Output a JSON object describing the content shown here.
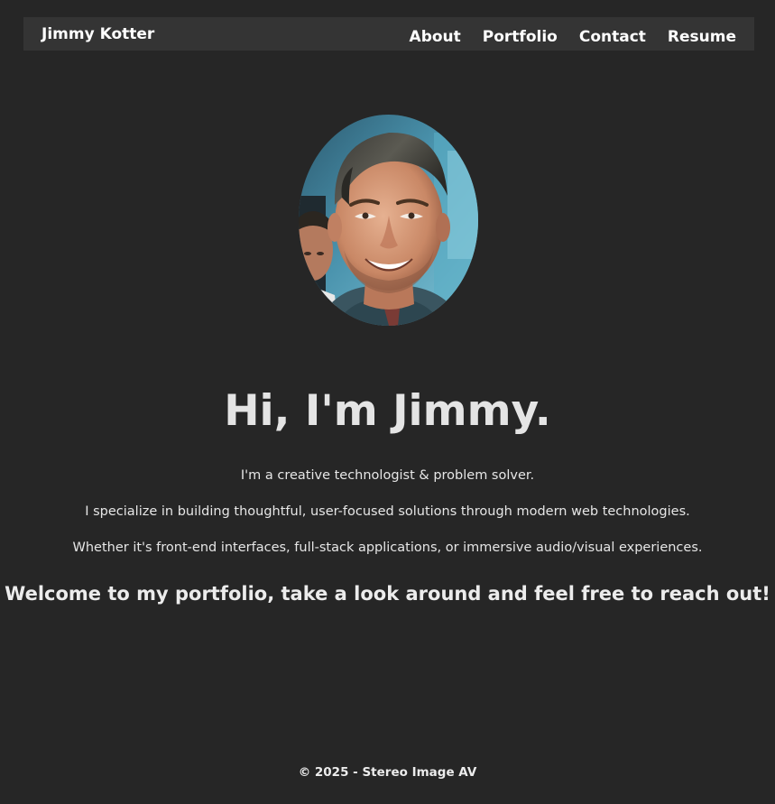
{
  "navbar": {
    "brand": "Jimmy Kotter",
    "links": [
      "About",
      "Portfolio",
      "Contact",
      "Resume"
    ]
  },
  "hero": {
    "title": "Hi, I'm Jimmy.",
    "lines": [
      "I'm a creative technologist & problem solver.",
      "I specialize in building thoughtful, user-focused solutions through modern web technologies.",
      "Whether it's front-end interfaces, full-stack applications, or immersive audio/visual experiences."
    ],
    "welcome": "Welcome to my portfolio, take a look around and feel free to reach out!"
  },
  "footer": {
    "text": "© 2025 - Stereo Image AV"
  },
  "colors": {
    "background": "#262626",
    "navbar": "#343434",
    "text": "#e9e9e9"
  }
}
